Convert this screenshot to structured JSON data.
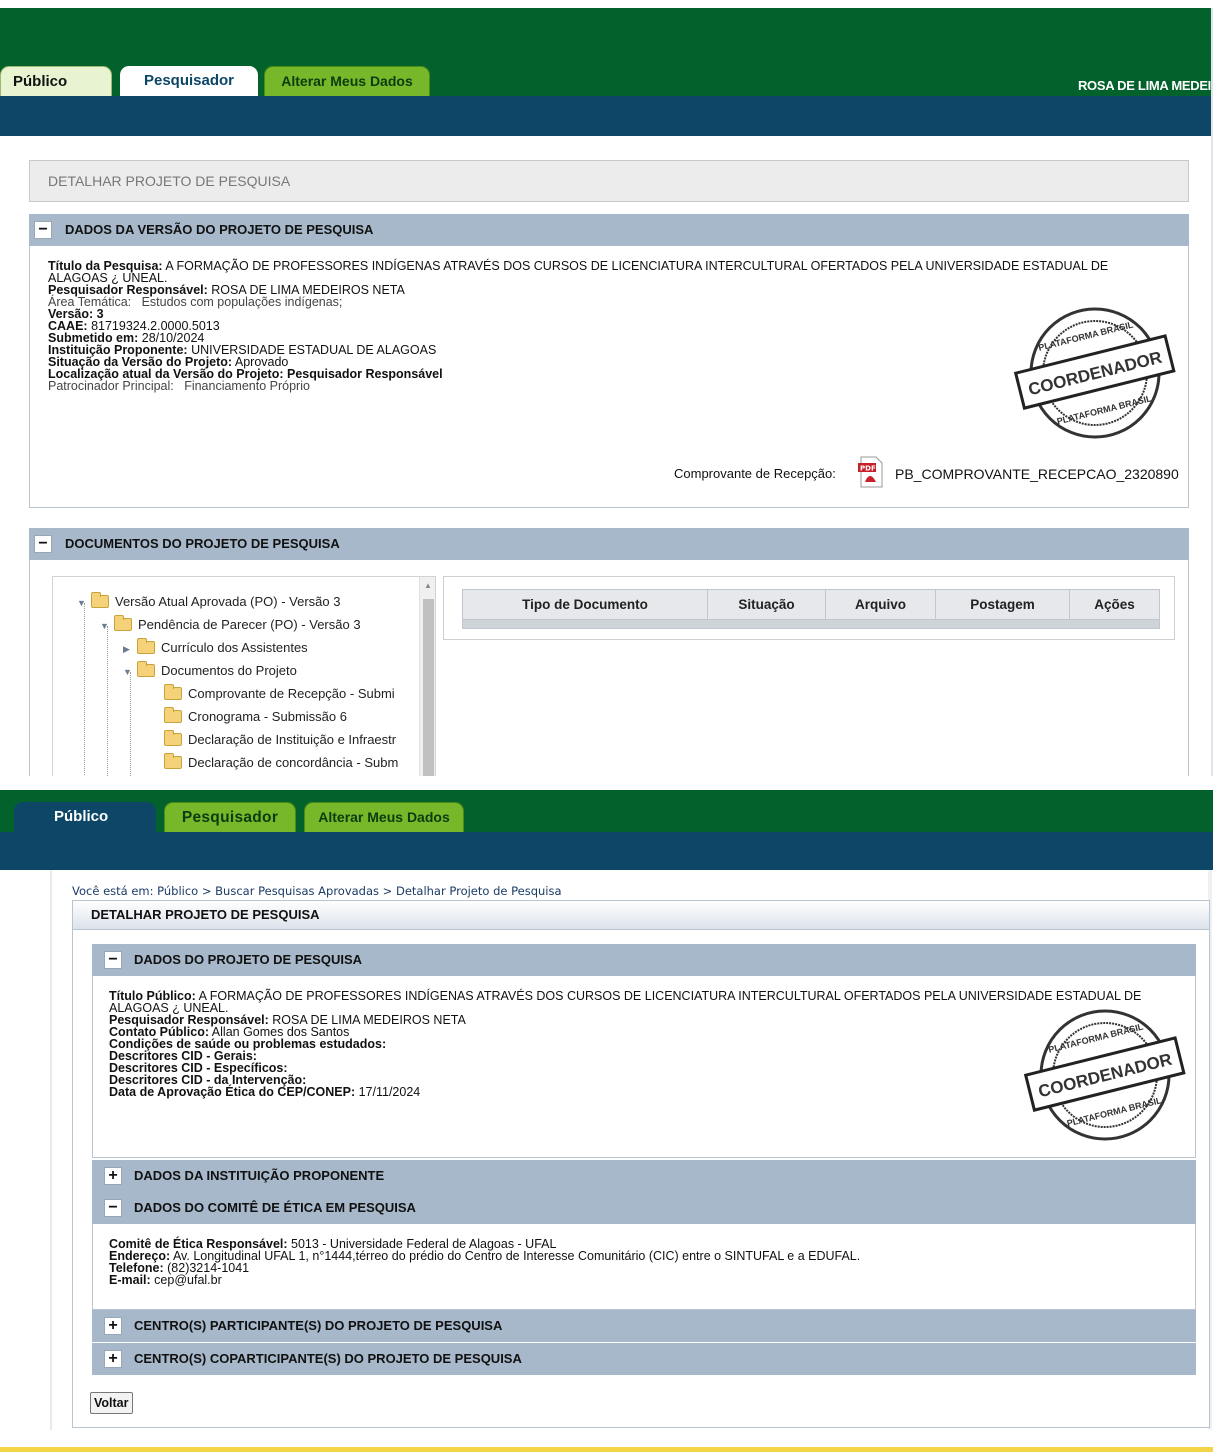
{
  "screen1": {
    "tabs": [
      "Público",
      "Pesquisador",
      "Alterar Meus Dados"
    ],
    "user_name": "ROSA DE LIMA MEDEI",
    "page_title": "DETALHAR PROJETO DE PESQUISA",
    "section_version": {
      "title": "DADOS DA VERSÃO DO PROJETO DE PESQUISA",
      "titulo_label": "Título da Pesquisa:",
      "titulo_value": "A FORMAÇÃO DE PROFESSORES INDÍGENAS ATRAVÉS DOS CURSOS DE LICENCIATURA INTERCULTURAL OFERTADOS PELA UNIVERSIDADE ESTADUAL DE ALAGOAS ¿ UNEAL.",
      "pesquisador_label": "Pesquisador Responsável:",
      "pesquisador_value": "ROSA DE LIMA MEDEIROS NETA",
      "area_label": "Área Temática:",
      "area_value": "Estudos com populações indígenas;",
      "versao_label": "Versão:",
      "versao_value": "3",
      "caae_label": "CAAE:",
      "caae_value": "81719324.2.0000.5013",
      "submetido_label": "Submetido em:",
      "submetido_value": "28/10/2024",
      "instituicao_label": "Instituição Proponente:",
      "instituicao_value": "UNIVERSIDADE ESTADUAL DE ALAGOAS",
      "situacao_label": "Situação da Versão do Projeto:",
      "situacao_value": "Aprovado",
      "localizacao_label": "Localização atual da Versão do Projeto:",
      "localizacao_value": "Pesquisador Responsável",
      "patrocinador_label": "Patrocinador Principal:",
      "patrocinador_value": "Financiamento Próprio",
      "comprovante_label": "Comprovante de Recepção:",
      "comprovante_file": "PB_COMPROVANTE_RECEPCAO_2320890"
    },
    "stamp": {
      "top_text": "PLATAFORMA BRASIL",
      "center_text": "COORDENADOR",
      "bottom_text": "PLATAFORMA BRASIL"
    },
    "section_docs": {
      "title": "DOCUMENTOS DO PROJETO DE PESQUISA",
      "tree": [
        "Versão Atual Aprovada (PO) - Versão 3",
        "Pendência de Parecer (PO) - Versão 3",
        "Currículo dos Assistentes",
        "Documentos do Projeto",
        "Comprovante de Recepção - Submi",
        "Cronograma - Submissão 6",
        "Declaração de Instituição e Infraestr",
        "Declaração de concordância - Subm"
      ],
      "table_headers": [
        "Tipo de Documento",
        "Situação",
        "Arquivo",
        "Postagem",
        "Ações"
      ]
    }
  },
  "screen2": {
    "tabs": [
      "Público",
      "Pesquisador",
      "Alterar Meus Dados"
    ],
    "breadcrumb": "Você está em: Público > Buscar Pesquisas Aprovadas > Detalhar Projeto de Pesquisa",
    "page_title": "DETALHAR PROJETO DE PESQUISA",
    "section_project": {
      "title": "DADOS DO PROJETO DE PESQUISA",
      "titulo_label": "Título Público:",
      "titulo_value": "A FORMAÇÃO DE PROFESSORES INDÍGENAS ATRAVÉS DOS CURSOS DE LICENCIATURA INTERCULTURAL OFERTADOS PELA UNIVERSIDADE ESTADUAL DE ALAGOAS ¿ UNEAL.",
      "pesquisador_label": "Pesquisador Responsável:",
      "pesquisador_value": "ROSA DE LIMA MEDEIROS NETA",
      "contato_label": "Contato Público:",
      "contato_value": "Allan Gomes dos Santos",
      "condicoes_label": "Condições de saúde ou problemas estudados:",
      "cid_gerais_label": "Descritores CID - Gerais:",
      "cid_especificos_label": "Descritores CID - Específicos:",
      "cid_intervencao_label": "Descritores CID - da Intervenção:",
      "data_aprovacao_label": "Data de Aprovação Ética do CEP/CONEP:",
      "data_aprovacao_value": "17/11/2024"
    },
    "section_instituicao": {
      "title": "DADOS DA INSTITUIÇÃO PROPONENTE"
    },
    "section_comite": {
      "title": "DADOS DO COMITÊ DE ÉTICA EM PESQUISA",
      "comite_label": "Comitê de Ética Responsável:",
      "comite_value": "5013 - Universidade Federal de Alagoas - UFAL",
      "endereco_label": "Endereço:",
      "endereco_value": "Av. Longitudinal UFAL 1, n°1444,térreo do prédio do Centro de Interesse Comunitário (CIC) entre o SINTUFAL e a EDUFAL.",
      "telefone_label": "Telefone:",
      "telefone_value": "(82)3214-1041",
      "email_label": "E-mail:",
      "email_value": "cep@ufal.br"
    },
    "section_centros": {
      "title": "CENTRO(S) PARTICIPANTE(S) DO PROJETO DE PESQUISA"
    },
    "section_coparticipantes": {
      "title": "CENTRO(S) COPARTICIPANTE(S) DO PROJETO DE PESQUISA"
    },
    "voltar_label": "Voltar",
    "toggle_minus": "−",
    "toggle_plus": "+"
  },
  "colors": {
    "green_bar": "#03622b",
    "navy_bar": "#0d4666",
    "section_header": "#a7b8ca",
    "tab_green": "#76b829",
    "tab_light": "#e8f3d1",
    "footer_accent": "#f5d547"
  },
  "icons": [
    "pdf-icon",
    "folder-icon",
    "tree-expand-icon",
    "tree-collapse-icon",
    "stamp-seal"
  ]
}
